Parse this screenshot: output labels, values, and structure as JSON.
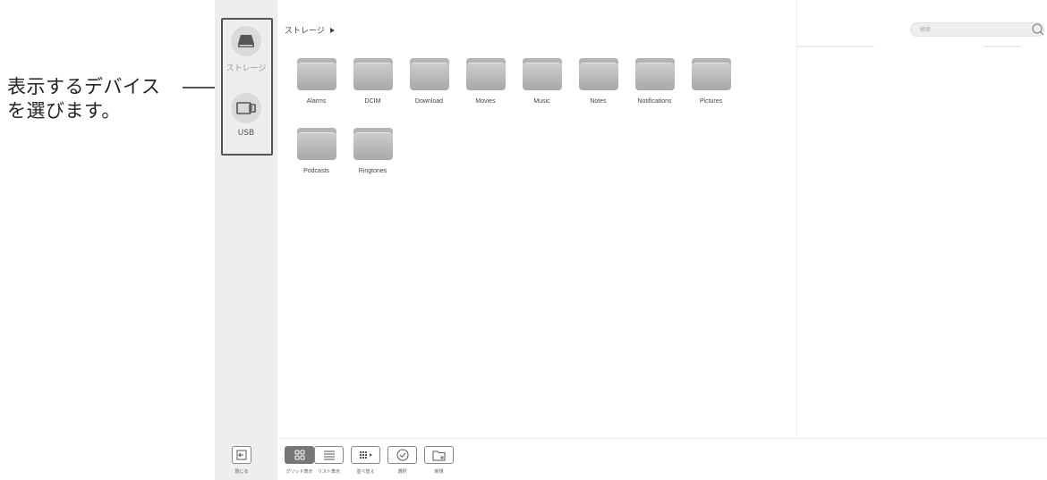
{
  "annotation": {
    "line1": "表示するデバイス",
    "line2": "を選びます。"
  },
  "sidebar": {
    "devices": [
      {
        "label": "ストレージ",
        "icon": "drive-icon"
      },
      {
        "label": "USB",
        "icon": "usb-icon"
      }
    ],
    "close_label": "閉じる"
  },
  "breadcrumb": {
    "label": "ストレージ"
  },
  "search": {
    "placeholder": "検索"
  },
  "folders": [
    {
      "name": "Alarms"
    },
    {
      "name": "DCIM"
    },
    {
      "name": "Download"
    },
    {
      "name": "Movies"
    },
    {
      "name": "Music"
    },
    {
      "name": "Notes"
    },
    {
      "name": "Notifications"
    },
    {
      "name": "Pictures"
    },
    {
      "name": "Podcasts"
    },
    {
      "name": "Ringtones"
    }
  ],
  "toolbar": {
    "grid_view": "グリッド表示",
    "list_view": "リスト表示",
    "sort": "並べ替え",
    "select": "選択",
    "new": "新規"
  }
}
